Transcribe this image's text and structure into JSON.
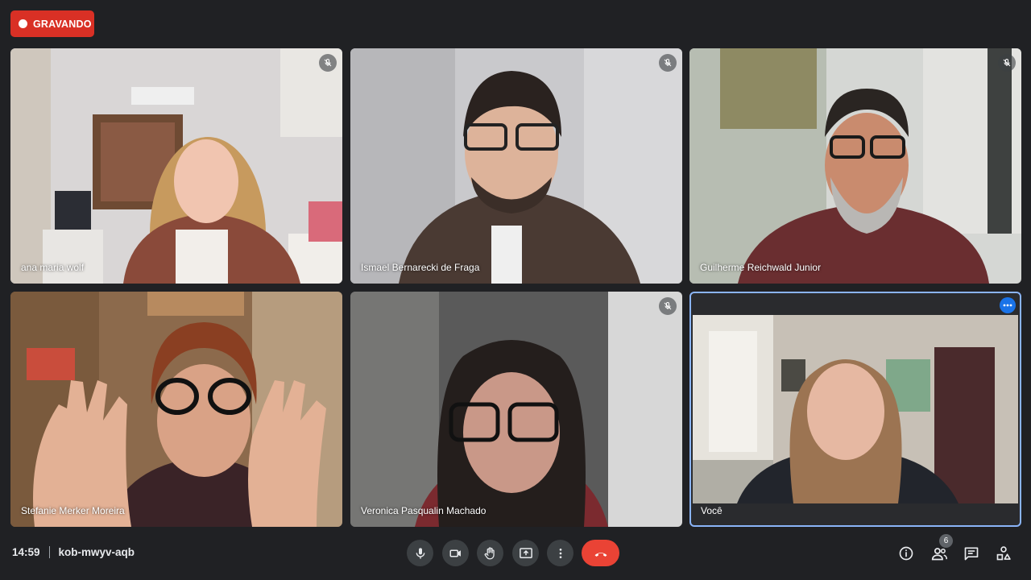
{
  "recording": {
    "label": "GRAVANDO"
  },
  "meeting": {
    "time": "14:59",
    "code": "kob-mwyv-aqb"
  },
  "participants": [
    {
      "name": "ana maria wolf",
      "muted": true
    },
    {
      "name": "Ismael Bernarecki de Fraga",
      "muted": true
    },
    {
      "name": "Guilherme Reichwald Junior",
      "muted": true
    },
    {
      "name": "Stefanie Merker Moreira",
      "muted": false
    },
    {
      "name": "Veronica Pasqualin Machado",
      "muted": true
    },
    {
      "name": "Você",
      "self": true
    }
  ],
  "controls": {
    "icons": [
      "microphone-icon",
      "camera-icon",
      "raise-hand-icon",
      "present-screen-icon",
      "more-options-icon",
      "hang-up-icon"
    ],
    "end_call_color": "#ea4335"
  },
  "side_panel": {
    "icons": [
      "info-icon",
      "people-icon",
      "chat-icon",
      "activities-icon"
    ],
    "people_count": "6"
  },
  "colors": {
    "background": "#202124",
    "recording": "#d93025",
    "self_border": "#8ab4f8"
  }
}
